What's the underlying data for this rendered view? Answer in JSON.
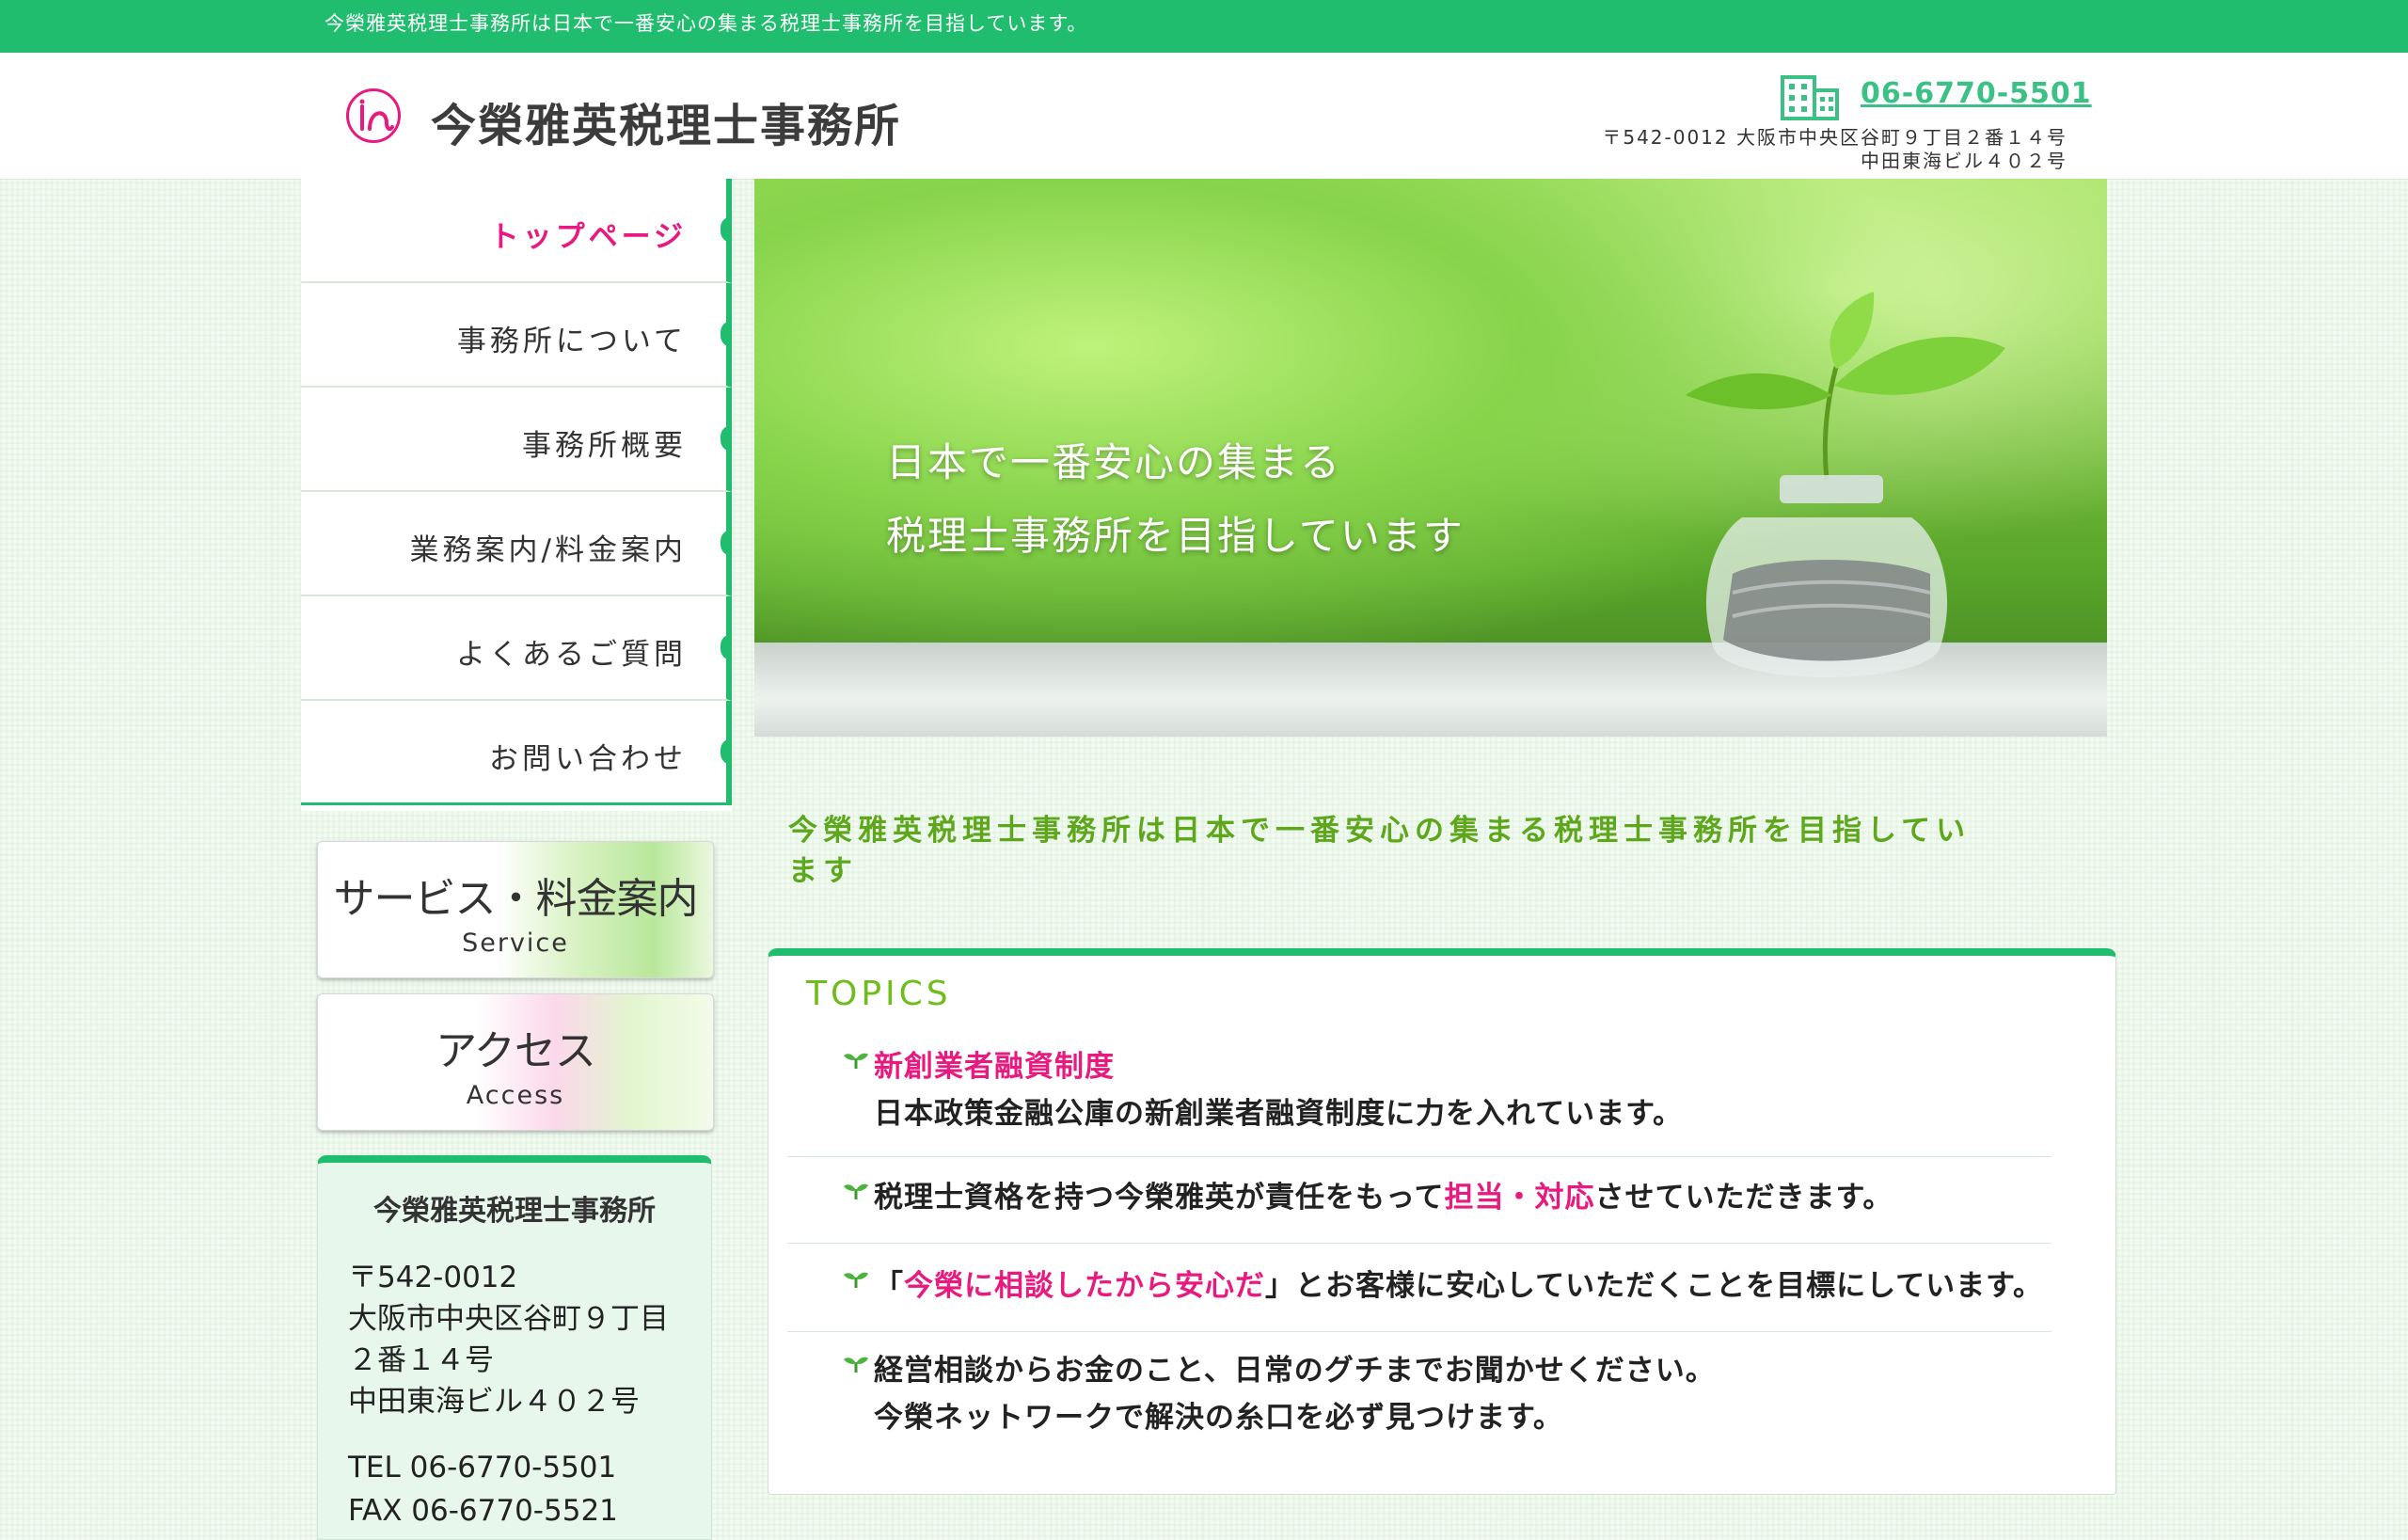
{
  "topbar": {
    "text": "今榮雅英税理士事務所は日本で一番安心の集まる税理士事務所を目指しています。"
  },
  "header": {
    "logo_text": "今榮雅英税理士事務所",
    "tel": "06-6770-5501",
    "address_line1": "〒542-0012 大阪市中央区谷町９丁目２番１４号",
    "address_line2": "中田東海ビル４０２号"
  },
  "nav": {
    "items": [
      {
        "label": "トップページ"
      },
      {
        "label": "事務所について"
      },
      {
        "label": "事務所概要"
      },
      {
        "label": "業務案内/料金案内"
      },
      {
        "label": "よくあるご質問"
      },
      {
        "label": "お問い合わせ"
      }
    ]
  },
  "banners": {
    "service": {
      "title": "サービス・料金案内",
      "sub": "Service"
    },
    "access": {
      "title": "アクセス",
      "sub": "Access"
    }
  },
  "info": {
    "name": "今榮雅英税理士事務所",
    "postal": "〒542-0012",
    "addr1": "大阪市中央区谷町９丁目",
    "addr2": "２番１４号",
    "addr3": "中田東海ビル４０２号",
    "tel": "TEL 06-6770-5501",
    "fax": "FAX 06-6770-5521"
  },
  "hero": {
    "line1": "日本で一番安心の集まる",
    "line2": "税理士事務所を目指しています"
  },
  "main": {
    "heading_line1": "今榮雅英税理士事務所は日本で一番安心の集まる税理士事務所を目指してい",
    "heading_line2": "ます"
  },
  "topics": {
    "title": "TOPICS",
    "t1_title": "新創業者融資制度",
    "t1_body": "日本政策金融公庫の新創業者融資制度に力を入れています。",
    "t2_pre": "税理士資格を持つ今榮雅英が責任をもって",
    "t2_em": "担当・対応",
    "t2_post": "させていただきます。",
    "t3_pre": "「",
    "t3_em": "今榮に相談したから安心だ",
    "t3_post": "」とお客様に安心していただくことを目標にしています。",
    "t4_line1": "経営相談からお金のこと、日常のグチまでお聞かせください。",
    "t4_line2": "今榮ネットワークで解決の糸口を必ず見つけます。"
  },
  "colors": {
    "brand_green": "#20bd6f",
    "accent_pink": "#e8197f",
    "heading_green": "#5ea71c"
  },
  "icons": [
    "logo-mark-icon",
    "building-icon",
    "sprout-icon"
  ]
}
